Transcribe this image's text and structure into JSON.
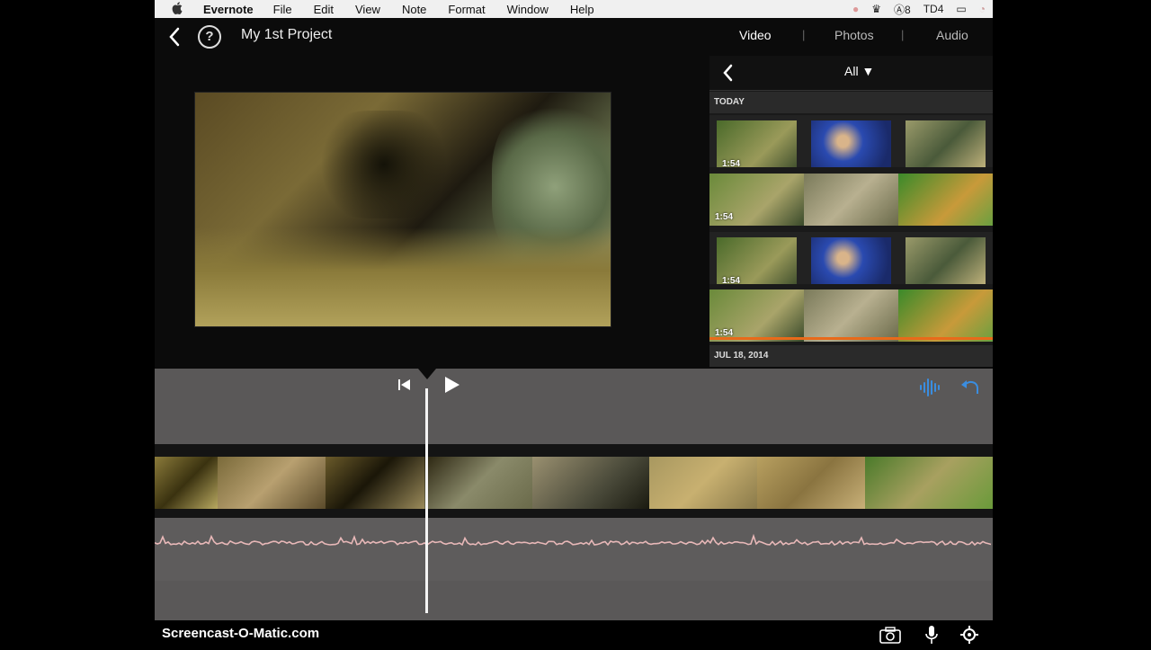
{
  "menubar": {
    "app_name": "Evernote",
    "items": [
      "File",
      "Edit",
      "View",
      "Note",
      "Format",
      "Window",
      "Help"
    ],
    "status": {
      "adobe": "8",
      "td": "4"
    }
  },
  "topbar": {
    "project_title": "My 1st Project",
    "tabs": [
      {
        "label": "Video",
        "active": true
      },
      {
        "label": "Photos",
        "active": false
      },
      {
        "label": "Audio",
        "active": false
      }
    ],
    "separator": "|"
  },
  "browser": {
    "filter_label": "All",
    "sections": [
      {
        "title": "TODAY"
      },
      {
        "title": "JUL 18, 2014"
      }
    ],
    "clips": [
      {
        "duration": "1:54",
        "type": "clip-row"
      },
      {
        "duration": "1:54",
        "type": "filmstrip"
      },
      {
        "duration": "1:54",
        "type": "clip-row"
      },
      {
        "duration": "1:54",
        "type": "filmstrip"
      }
    ]
  },
  "bottombar": {
    "watermark": "Screencast-O-Matic.com"
  },
  "colors": {
    "accent_selection": "#e86a1a",
    "timeline_bg": "#5a5858",
    "audio_wave": "#e8b8b8",
    "waveform_icon": "#3a8de0"
  },
  "icons": [
    "apple-icon",
    "back-chevron-icon",
    "help-icon",
    "skip-to-start-icon",
    "play-icon",
    "waveform-icon",
    "undo-icon",
    "camera-icon",
    "microphone-icon",
    "settings-gear-icon"
  ]
}
